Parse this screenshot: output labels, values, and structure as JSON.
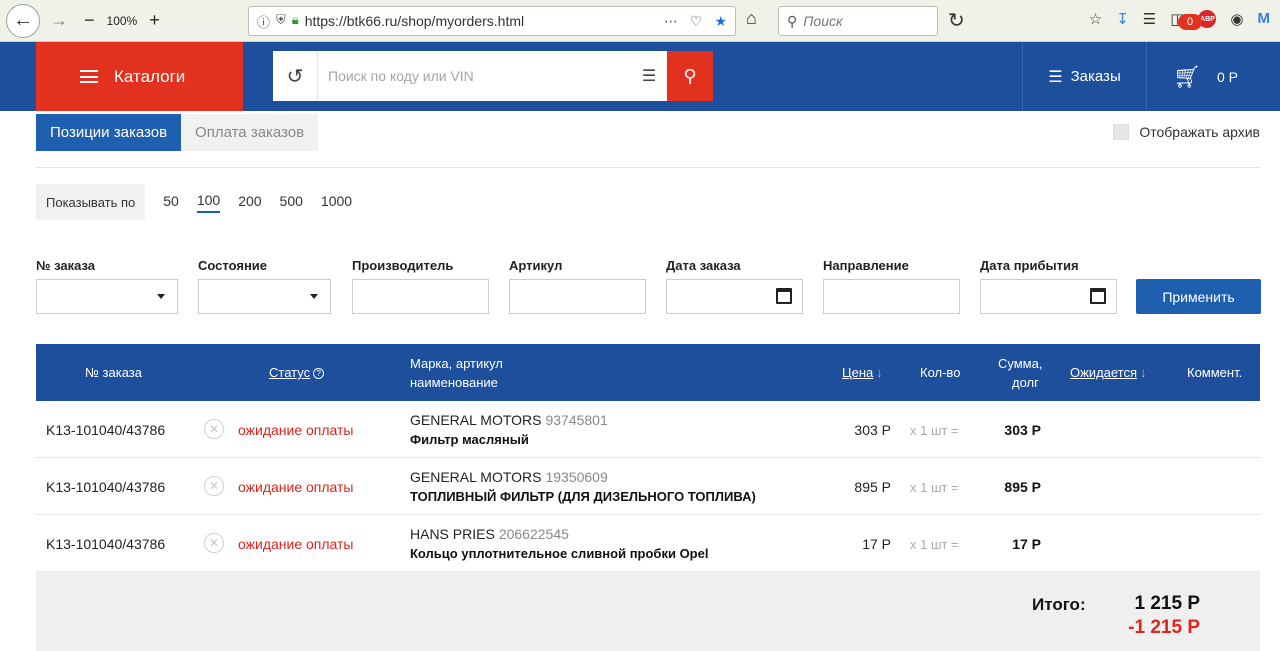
{
  "browser": {
    "zoom": "100%",
    "url": "https://btk66.ru/shop/myorders.html",
    "search_placeholder": "Поиск",
    "abp_label": "ABP"
  },
  "header": {
    "catalog_label": "Каталоги",
    "search_placeholder": "Поиск по коду или VIN",
    "orders_label": "Заказы",
    "cart_count": "0",
    "cart_sum": "0 Р"
  },
  "tabs": [
    {
      "label": "Позиции заказов",
      "active": true
    },
    {
      "label": "Оплата заказов",
      "active": false
    }
  ],
  "archive_label": "Отображать архив",
  "page_size": {
    "label": "Показывать по",
    "options": [
      "50",
      "100",
      "200",
      "500",
      "1000"
    ],
    "selected": "100"
  },
  "filters": {
    "order_no": "№ заказа",
    "state": "Состояние",
    "manufacturer": "Производитель",
    "article": "Артикул",
    "order_date": "Дата заказа",
    "direction": "Направление",
    "arrival_date": "Дата прибытия",
    "apply": "Применить"
  },
  "table": {
    "headers": {
      "order_no": "№ заказа",
      "status": "Статус",
      "brand_line1": "Марка, артикул",
      "brand_line2": "наименование",
      "price": "Цена",
      "qty": "Кол-во",
      "sum_line1": "Сумма,",
      "sum_line2": "долг",
      "expected": "Ожидается",
      "comment": "Коммент."
    },
    "rows": [
      {
        "order_no": "K13-101040/43786",
        "status": "ожидание оплаты",
        "brand": "GENERAL MOTORS",
        "article": "93745801",
        "name": "Фильтр масляный",
        "price": "303 Р",
        "qty": "х 1 шт =",
        "sum": "303 Р"
      },
      {
        "order_no": "K13-101040/43786",
        "status": "ожидание оплаты",
        "brand": "GENERAL MOTORS",
        "article": "19350609",
        "name": "ТОПЛИВНЫЙ ФИЛЬТР (ДЛЯ ДИЗЕЛЬНОГО ТОПЛИВА)",
        "price": "895 Р",
        "qty": "х 1 шт =",
        "sum": "895 Р"
      },
      {
        "order_no": "K13-101040/43786",
        "status": "ожидание оплаты",
        "brand": "HANS PRIES",
        "article": "206622545",
        "name": "Кольцо уплотнительное сливной пробки Opel",
        "price": "17 Р",
        "qty": "х 1 шт =",
        "sum": "17 Р"
      }
    ]
  },
  "totals": {
    "label": "Итого:",
    "sum": "1 215 Р",
    "debt": "-1 215 Р"
  },
  "colors": {
    "header_blue": "#1d4f9c",
    "accent_red": "#e2321f",
    "status_red": "#e2231a",
    "tab_blue": "#1f5fb0"
  }
}
